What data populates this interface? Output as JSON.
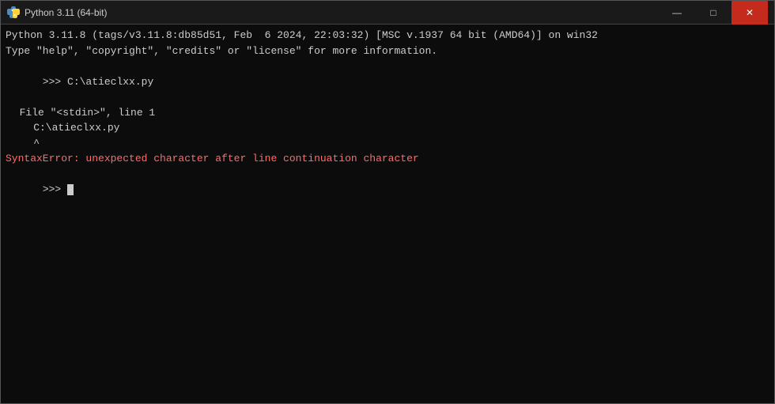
{
  "titleBar": {
    "title": "Python 3.11 (64-bit)",
    "minimize_label": "—",
    "maximize_label": "□",
    "close_label": "✕"
  },
  "terminal": {
    "line1": "Python 3.11.8 (tags/v3.11.8:db85d51, Feb  6 2024, 22:03:32) [MSC v.1937 64 bit (AMD64)] on win32",
    "line2": "Type \"help\", \"copyright\", \"credits\" or \"license\" for more information.",
    "line3_prompt": ">>> ",
    "line3_cmd": "C:\\atieclxx.py",
    "line4": "  File \"<stdin>\", line 1",
    "line5": "    C:\\atieclxx.py",
    "line6": "    ^",
    "line7": "SyntaxError: unexpected character after line continuation character",
    "line8_prompt": ">>> "
  }
}
